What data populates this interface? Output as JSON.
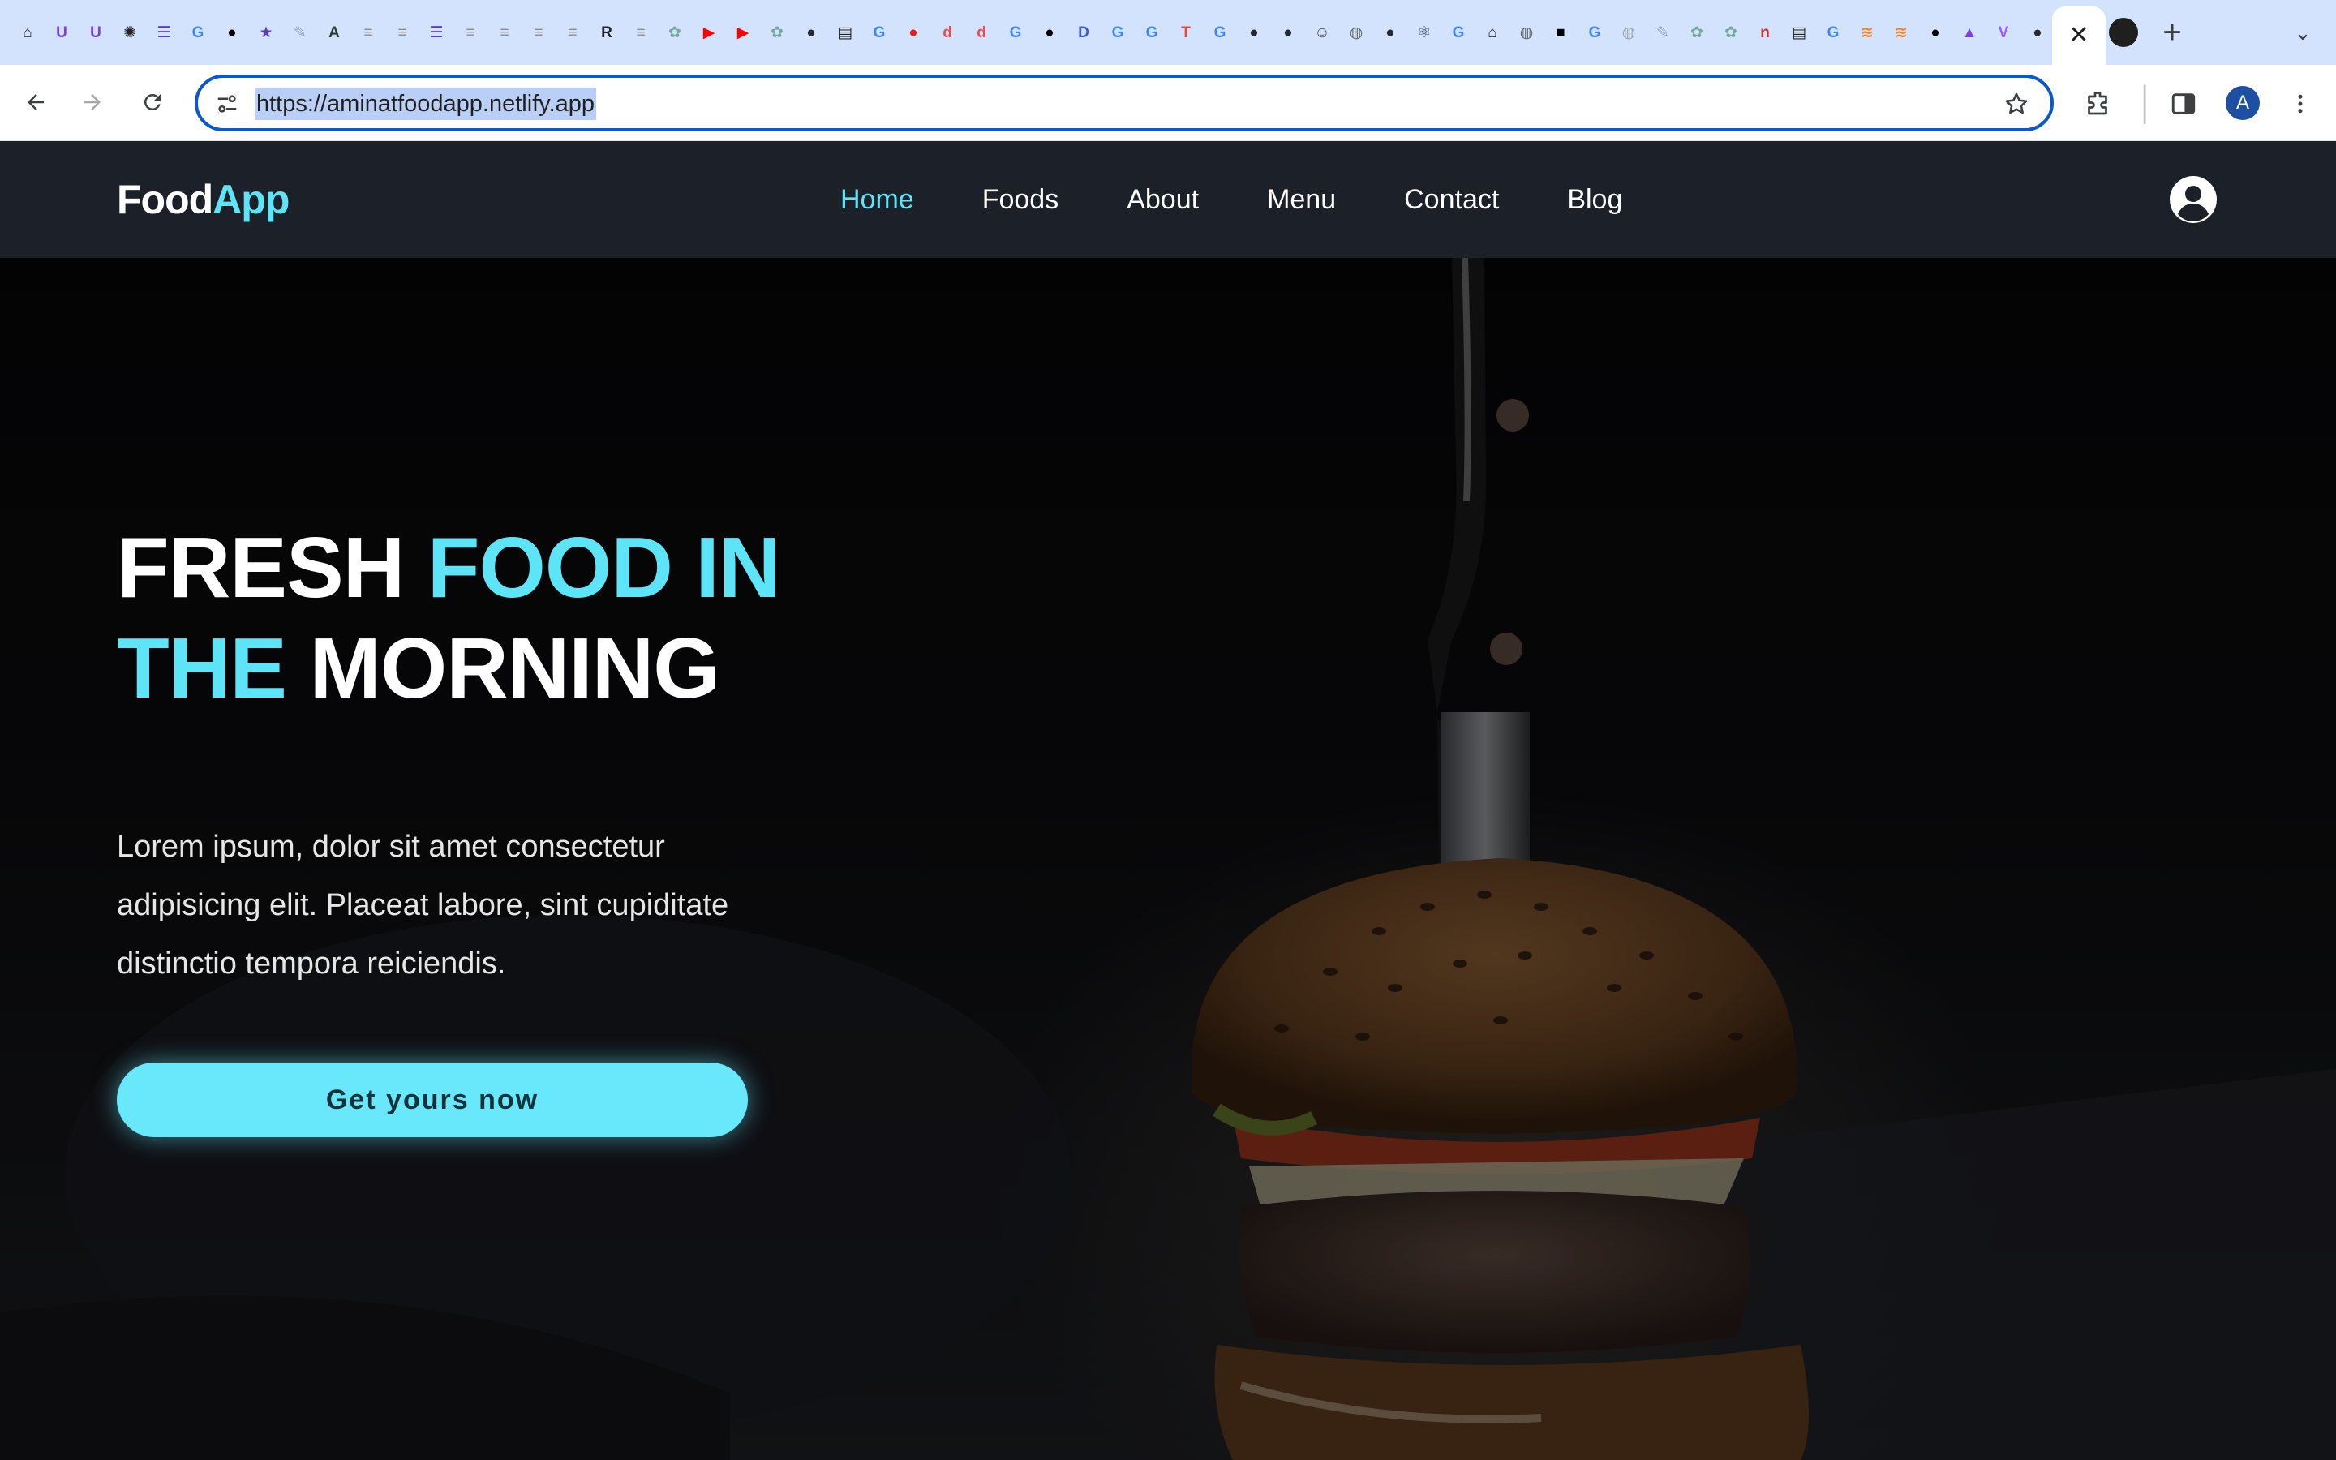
{
  "browser": {
    "url": "https://aminatfoodapp.netlify.app",
    "active_tab_close": "✕",
    "new_tab": "+",
    "tab_list": "⌄",
    "favicons": [
      {
        "icon": "house-icon",
        "glyph": "⌂",
        "color": "#1f1f1f"
      },
      {
        "icon": "u-icon",
        "glyph": "U",
        "color": "#7b3fe4"
      },
      {
        "icon": "u-icon",
        "glyph": "U",
        "color": "#7b3fe4"
      },
      {
        "icon": "sparkle-icon",
        "glyph": "✺",
        "color": "#1f1f1f"
      },
      {
        "icon": "list-icon",
        "glyph": "☰",
        "color": "#5b3bd6"
      },
      {
        "icon": "google-icon",
        "glyph": "G",
        "color": "#4285f4"
      },
      {
        "icon": "medium-icon",
        "glyph": "●",
        "color": "#000000"
      },
      {
        "icon": "star-icon",
        "glyph": "★",
        "color": "#5a3bb8"
      },
      {
        "icon": "feather-icon",
        "glyph": "✎",
        "color": "#9ba8c9"
      },
      {
        "icon": "a-icon",
        "glyph": "A",
        "color": "#2e3a2e"
      },
      {
        "icon": "doc-icon",
        "glyph": "≡",
        "color": "#8b8b8b"
      },
      {
        "icon": "doc-icon",
        "glyph": "≡",
        "color": "#8b8b8b"
      },
      {
        "icon": "list-icon",
        "glyph": "☰",
        "color": "#5b3bd6"
      },
      {
        "icon": "doc-icon",
        "glyph": "≡",
        "color": "#8b8b8b"
      },
      {
        "icon": "doc-icon",
        "glyph": "≡",
        "color": "#8b8b8b"
      },
      {
        "icon": "doc-icon",
        "glyph": "≡",
        "color": "#8b8b8b"
      },
      {
        "icon": "doc-icon",
        "glyph": "≡",
        "color": "#8b8b8b"
      },
      {
        "icon": "r-icon",
        "glyph": "R",
        "color": "#222233"
      },
      {
        "icon": "doc-icon",
        "glyph": "≡",
        "color": "#8b8b8b"
      },
      {
        "icon": "openai-icon",
        "glyph": "✿",
        "color": "#74aa9c"
      },
      {
        "icon": "youtube-icon",
        "glyph": "▶",
        "color": "#ff0000"
      },
      {
        "icon": "youtube-icon",
        "glyph": "▶",
        "color": "#ff0000"
      },
      {
        "icon": "openai-icon",
        "glyph": "✿",
        "color": "#74aa9c"
      },
      {
        "icon": "github-icon",
        "glyph": "●",
        "color": "#24292f"
      },
      {
        "icon": "notes-icon",
        "glyph": "▤",
        "color": "#1f1f1f"
      },
      {
        "icon": "google-icon",
        "glyph": "G",
        "color": "#4285f4"
      },
      {
        "icon": "record-icon",
        "glyph": "●",
        "color": "#e0201c"
      },
      {
        "icon": "d-icon",
        "glyph": "d",
        "color": "#ef4b4b"
      },
      {
        "icon": "d-icon",
        "glyph": "d",
        "color": "#ef4b4b"
      },
      {
        "icon": "google-icon",
        "glyph": "G",
        "color": "#4285f4"
      },
      {
        "icon": "medium-icon",
        "glyph": "●",
        "color": "#000000"
      },
      {
        "icon": "d-icon",
        "glyph": "D",
        "color": "#3b5bdb"
      },
      {
        "icon": "google-icon",
        "glyph": "G",
        "color": "#4285f4"
      },
      {
        "icon": "google-icon",
        "glyph": "G",
        "color": "#4285f4"
      },
      {
        "icon": "t-icon",
        "glyph": "T",
        "color": "#e8453c"
      },
      {
        "icon": "google-icon",
        "glyph": "G",
        "color": "#4285f4"
      },
      {
        "icon": "github-icon",
        "glyph": "●",
        "color": "#24292f"
      },
      {
        "icon": "github-icon",
        "glyph": "●",
        "color": "#24292f"
      },
      {
        "icon": "robot-icon",
        "glyph": "☺",
        "color": "#5a5a5a"
      },
      {
        "icon": "globe-icon",
        "glyph": "◍",
        "color": "#5f6368"
      },
      {
        "icon": "github-icon",
        "glyph": "●",
        "color": "#24292f"
      },
      {
        "icon": "react-icon",
        "glyph": "⚛",
        "color": "#1b3b4a"
      },
      {
        "icon": "google-icon",
        "glyph": "G",
        "color": "#4285f4"
      },
      {
        "icon": "house-icon",
        "glyph": "⌂",
        "color": "#1f1f1f"
      },
      {
        "icon": "globe-icon",
        "glyph": "◍",
        "color": "#5f6368"
      },
      {
        "icon": "box-icon",
        "glyph": "■",
        "color": "#000000"
      },
      {
        "icon": "google-icon",
        "glyph": "G",
        "color": "#4285f4"
      },
      {
        "icon": "globe-icon",
        "glyph": "◍",
        "color": "#9aa0a6"
      },
      {
        "icon": "feather-icon",
        "glyph": "✎",
        "color": "#9ba8c9"
      },
      {
        "icon": "openai-icon",
        "glyph": "✿",
        "color": "#74aa9c"
      },
      {
        "icon": "openai-icon",
        "glyph": "✿",
        "color": "#74aa9c"
      },
      {
        "icon": "n-icon",
        "glyph": "n",
        "color": "#d32f2f"
      },
      {
        "icon": "notes-icon",
        "glyph": "▤",
        "color": "#1f1f1f"
      },
      {
        "icon": "google-icon",
        "glyph": "G",
        "color": "#4285f4"
      },
      {
        "icon": "stack-icon",
        "glyph": "≋",
        "color": "#f48024"
      },
      {
        "icon": "stack-icon",
        "glyph": "≋",
        "color": "#f48024"
      },
      {
        "icon": "medium-icon",
        "glyph": "●",
        "color": "#000000"
      },
      {
        "icon": "rocket-icon",
        "glyph": "▲",
        "color": "#7b3fe4"
      },
      {
        "icon": "vite-icon",
        "glyph": "V",
        "color": "#a259ff"
      },
      {
        "icon": "github-icon",
        "glyph": "●",
        "color": "#24292f"
      }
    ]
  },
  "site": {
    "logo": {
      "part1": "Food",
      "part2": "App"
    },
    "nav": [
      "Home",
      "Foods",
      "About",
      "Menu",
      "Contact",
      "Blog"
    ],
    "active_nav": "Home",
    "accent_color": "#5de4f6"
  },
  "hero": {
    "title": {
      "w1": "FRESH",
      "w2": "FOOD IN",
      "w3": "THE",
      "w4": "MORNING"
    },
    "text": "Lorem ipsum, dolor sit amet consectetur adipisicing elit. Placeat labore, sint cupiditate distinctio tempora reiciendis.",
    "cta": "Get yours now"
  }
}
